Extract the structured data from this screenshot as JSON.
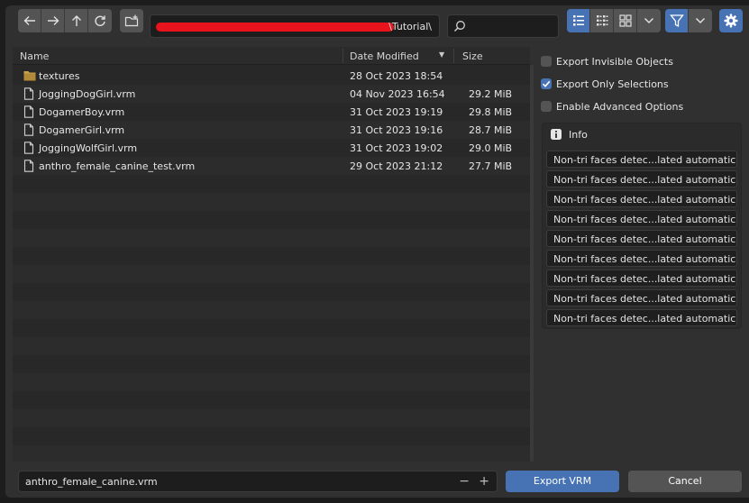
{
  "toolbar": {
    "path_value": "\\Tutorial\\",
    "search_value": ""
  },
  "columns": {
    "name": "Name",
    "date": "Date Modified",
    "size": "Size"
  },
  "files": [
    {
      "name": "textures",
      "date": "28 Oct 2023 18:54",
      "size": "",
      "type": "folder"
    },
    {
      "name": "JoggingDogGirl.vrm",
      "date": "04 Nov 2023 16:54",
      "size": "29.2 MiB",
      "type": "file"
    },
    {
      "name": "DogamerBoy.vrm",
      "date": "31 Oct 2023 19:19",
      "size": "29.8 MiB",
      "type": "file"
    },
    {
      "name": "DogamerGirl.vrm",
      "date": "31 Oct 2023 19:16",
      "size": "28.7 MiB",
      "type": "file"
    },
    {
      "name": "JoggingWolfGirl.vrm",
      "date": "31 Oct 2023 19:02",
      "size": "29.0 MiB",
      "type": "file"
    },
    {
      "name": "anthro_female_canine_test.vrm",
      "date": "29 Oct 2023 21:12",
      "size": "27.7 MiB",
      "type": "file"
    }
  ],
  "options": {
    "export_invisible": {
      "label": "Export Invisible Objects",
      "checked": false
    },
    "export_only_selections": {
      "label": "Export Only Selections",
      "checked": true
    },
    "enable_advanced": {
      "label": "Enable Advanced Options",
      "checked": false
    }
  },
  "info": {
    "title": "Info",
    "messages": [
      "Non-tri faces detec...lated automatically.",
      "Non-tri faces detec...lated automatically.",
      "Non-tri faces detec...lated automatically.",
      "Non-tri faces detec...lated automatically.",
      "Non-tri faces detec...lated automatically.",
      "Non-tri faces detec...lated automatically.",
      "Non-tri faces detec...lated automatically.",
      "Non-tri faces detec...lated automatically.",
      "Non-tri faces detec...lated automatically."
    ]
  },
  "bottom": {
    "filename": "anthro_female_canine.vrm",
    "minus": "−",
    "plus": "+",
    "export_label": "Export VRM",
    "cancel_label": "Cancel"
  },
  "colors": {
    "accent": "#4772b3",
    "redaction": "#e8131c",
    "folder": "#c9a24a"
  }
}
